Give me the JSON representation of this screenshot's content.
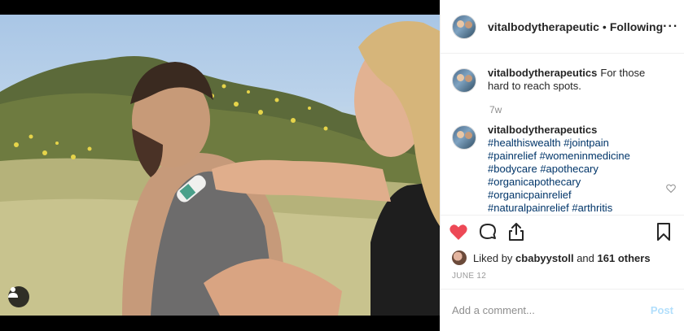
{
  "post": {
    "username": "vitalbodytherapeutic",
    "separator": "•",
    "follow_status": "Following",
    "more_icon": "more-horizontal-icon"
  },
  "caption": {
    "username": "vitalbodytherapeutics",
    "text": "For those hard to reach spots.",
    "time": "7w"
  },
  "comment": {
    "username": "vitalbodytherapeutics",
    "hashtags": [
      "#healthiswealth #jointpain",
      "#painrelief #womeninmedicine",
      "#bodycare #apothecary",
      "#organicapothecary",
      "#organicpainrelief",
      "#naturalpainrelief #arthritis"
    ]
  },
  "actions": {
    "like_icon": "heart-icon",
    "comment_icon": "comment-icon",
    "share_icon": "share-icon",
    "save_icon": "bookmark-icon",
    "like_color": "#ed4956"
  },
  "likes": {
    "prefix": "Liked by",
    "user": "cbabyystoll",
    "middle": "and",
    "others": "161 others"
  },
  "date": "JUNE 12",
  "add_comment": {
    "placeholder": "Add a comment...",
    "post_label": "Post"
  }
}
